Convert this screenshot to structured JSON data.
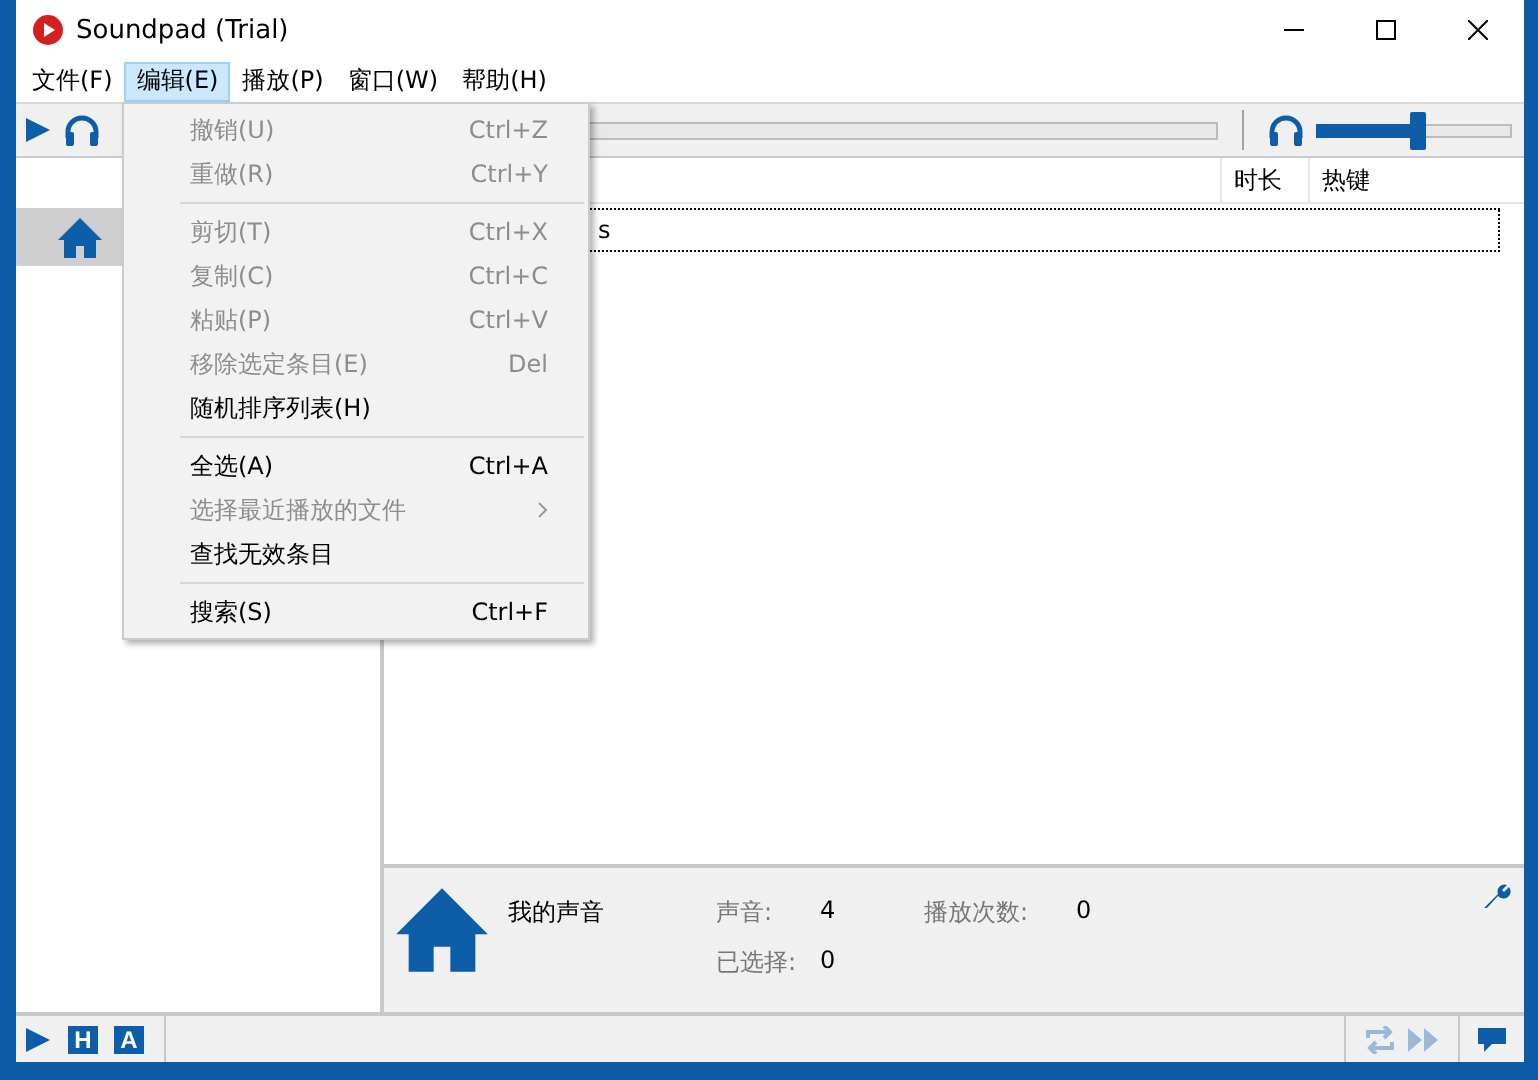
{
  "window": {
    "title": "Soundpad (Trial)"
  },
  "menu_bar": [
    {
      "label": "文件(F)",
      "selected": false
    },
    {
      "label": "编辑(E)",
      "selected": true
    },
    {
      "label": "播放(P)",
      "selected": false
    },
    {
      "label": "窗口(W)",
      "selected": false
    },
    {
      "label": "帮助(H)",
      "selected": false
    }
  ],
  "toolbar": {
    "volume": {
      "level": 0.52
    }
  },
  "sidebar": {
    "items": [
      {
        "selected": true
      }
    ]
  },
  "table": {
    "columns": [
      "时长",
      "热键"
    ],
    "rows": [
      {
        "cell_1": "s",
        "selected": true
      }
    ]
  },
  "info_panel": {
    "title": "我的声音",
    "stats": [
      {
        "label": "声音:",
        "value": "4"
      },
      {
        "label": "播放次数:",
        "value": "0"
      },
      {
        "label": "已选择:",
        "value": "0"
      }
    ]
  },
  "edit_menu": [
    {
      "kind": "item",
      "label": "撤销(U)",
      "shortcut": "Ctrl+Z",
      "disabled": true
    },
    {
      "kind": "item",
      "label": "重做(R)",
      "shortcut": "Ctrl+Y",
      "disabled": true
    },
    {
      "kind": "separator"
    },
    {
      "kind": "item",
      "label": "剪切(T)",
      "shortcut": "Ctrl+X",
      "disabled": true
    },
    {
      "kind": "item",
      "label": "复制(C)",
      "shortcut": "Ctrl+C",
      "disabled": true
    },
    {
      "kind": "item",
      "label": "粘贴(P)",
      "shortcut": "Ctrl+V",
      "disabled": true
    },
    {
      "kind": "item",
      "label": "移除选定条目(E)",
      "shortcut": "Del",
      "disabled": true
    },
    {
      "kind": "item",
      "label": "随机排序列表(H)",
      "disabled": false
    },
    {
      "kind": "separator"
    },
    {
      "kind": "item",
      "label": "全选(A)",
      "shortcut": "Ctrl+A",
      "disabled": false
    },
    {
      "kind": "submenu",
      "label": "选择最近播放的文件",
      "disabled": true
    },
    {
      "kind": "item",
      "label": "查找无效条目",
      "disabled": false
    },
    {
      "kind": "separator"
    },
    {
      "kind": "item",
      "label": "搜索(S)",
      "shortcut": "Ctrl+F",
      "disabled": false
    }
  ],
  "status_bar": {
    "hotkeys": [
      {
        "letter": "H"
      },
      {
        "letter": "A"
      }
    ],
    "repeat": {
      "disabled": true
    },
    "skip": {
      "disabled": true
    }
  }
}
